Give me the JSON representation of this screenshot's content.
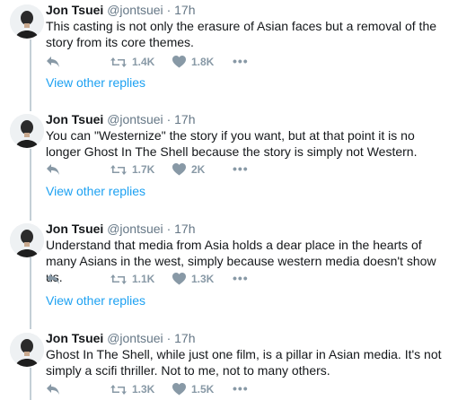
{
  "tweets": [
    {
      "name": "Jon Tsuei",
      "handle": "@jontsuei",
      "separator": "·",
      "time": "17h",
      "text": "This casting is not only the erasure of Asian faces but a removal of the story from its core themes.",
      "retweets": "1.4K",
      "likes": "1.8K",
      "more": "•••",
      "view_replies": "View other replies"
    },
    {
      "name": "Jon Tsuei",
      "handle": "@jontsuei",
      "separator": "·",
      "time": "17h",
      "text": "You can \"Westernize\" the story if you want, but at that point it is no longer Ghost In The Shell because the story is simply not Western.",
      "retweets": "1.7K",
      "likes": "2K",
      "more": "•••",
      "view_replies": "View other replies"
    },
    {
      "name": "Jon Tsuei",
      "handle": "@jontsuei",
      "separator": "·",
      "time": "17h",
      "text": "Understand that media from Asia holds a dear place in the hearts of many Asians in the west, simply because western media doesn't show us.",
      "retweets": "1.1K",
      "likes": "1.3K",
      "more": "•••",
      "view_replies": "View other replies"
    },
    {
      "name": "Jon Tsuei",
      "handle": "@jontsuei",
      "separator": "·",
      "time": "17h",
      "text": "Ghost In The Shell, while just one film, is a pillar in Asian media. It's not simply a scifi thriller. Not to me, not to many others.",
      "retweets": "1.3K",
      "likes": "1.5K",
      "more": "•••"
    }
  ],
  "colors": {
    "link": "#1da1f2",
    "action_gray": "#8899a6",
    "thread_line": "#c4cfd6"
  }
}
